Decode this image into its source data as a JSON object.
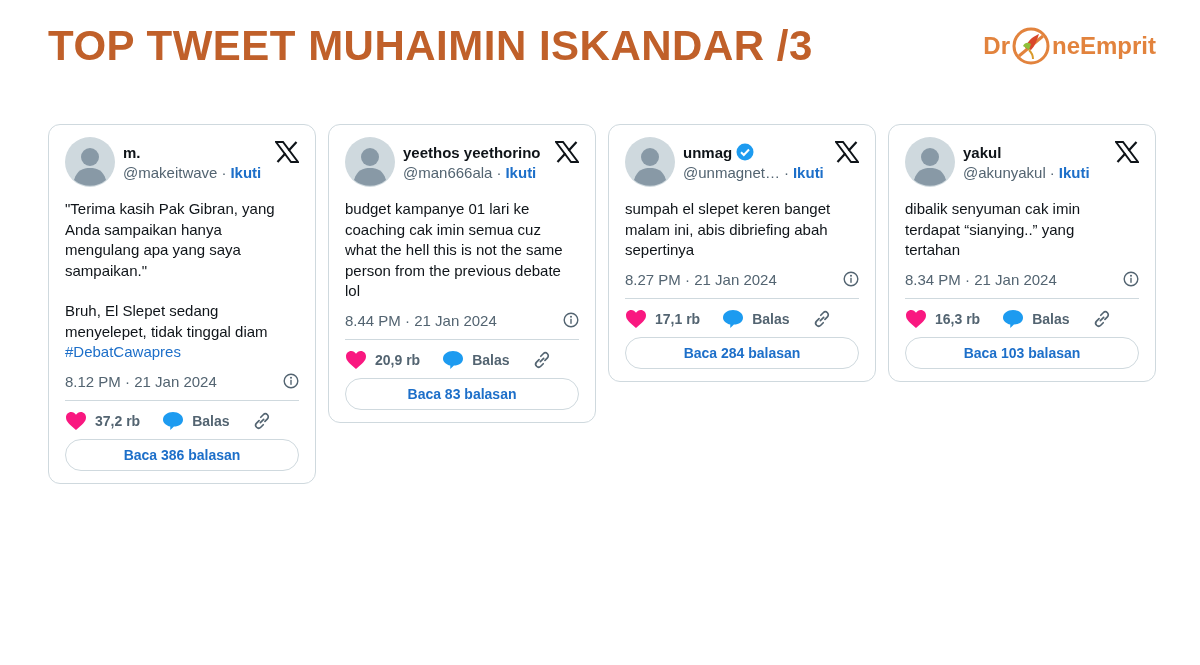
{
  "title": "TOP TWEET MUHAIMIN ISKANDAR /3",
  "logo": {
    "left": "Dr",
    "right": "neEmprit"
  },
  "tweets": [
    {
      "name": "m.",
      "verified": false,
      "handle": "@makeitwave",
      "separator": "·",
      "follow": "Ikuti",
      "paragraphs": [
        "\"Terima kasih Pak Gibran, yang Anda sampaikan hanya mengulang apa yang saya sampaikan.\"",
        "Bruh, El Slepet sedang menyelepet, tidak tinggal diam"
      ],
      "hashtag": "#DebatCawapres",
      "time": "8.12 PM · 21 Jan 2024",
      "likes": "37,2 rb",
      "reply": "Balas",
      "read": "Baca 386 balasan"
    },
    {
      "name": "yeethos yeethorino",
      "verified": false,
      "handle": "@man666ala",
      "separator": "·",
      "follow": "Ikuti",
      "paragraphs": [
        "budget kampanye 01 lari ke coaching cak imin semua cuz what the hell this is not the same person from the previous debate lol"
      ],
      "time": "8.44 PM · 21 Jan 2024",
      "likes": "20,9 rb",
      "reply": "Balas",
      "read": "Baca 83 balasan"
    },
    {
      "name": "unmag",
      "verified": true,
      "handle": "@unmagnet…",
      "separator": "·",
      "follow": "Ikuti",
      "paragraphs": [
        "sumpah el slepet keren banget malam ini, abis dibriefing abah sepertinya"
      ],
      "time": "8.27 PM · 21 Jan 2024",
      "likes": "17,1 rb",
      "reply": "Balas",
      "read": "Baca 284 balasan"
    },
    {
      "name": "yakul",
      "verified": false,
      "handle": "@akunyakul",
      "separator": "·",
      "follow": "Ikuti",
      "paragraphs": [
        "dibalik senyuman cak imin terdapat “sianying..” yang tertahan"
      ],
      "time": "8.34 PM · 21 Jan 2024",
      "likes": "16,3 rb",
      "reply": "Balas",
      "read": "Baca 103 balasan"
    }
  ]
}
